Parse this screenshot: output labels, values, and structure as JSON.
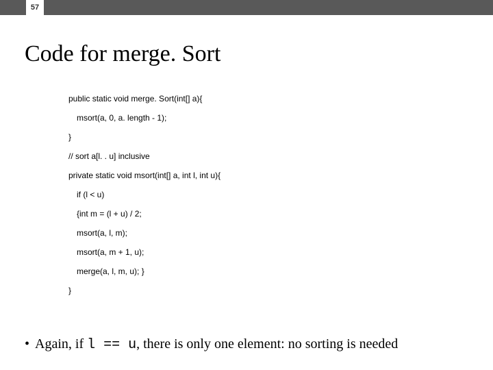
{
  "page_number": "57",
  "title": "Code for merge. Sort",
  "code": {
    "l1": "public static void merge. Sort(int[] a){",
    "l2": "msort(a, 0, a. length - 1);",
    "l3": "}",
    "l4": "// sort a[l. . u] inclusive",
    "l5": "private static void msort(int[] a, int l, int u){",
    "l6": "if (l < u)",
    "l7": "{int m = (l + u) / 2;",
    "l8": "msort(a, l, m);",
    "l9": "msort(a, m + 1, u);",
    "l10": "merge(a, l, m, u); }",
    "l11": "}"
  },
  "bullet": {
    "prefix": "Again, if ",
    "cond": "l == u",
    "suffix": ", there is only one element: no sorting is needed"
  }
}
